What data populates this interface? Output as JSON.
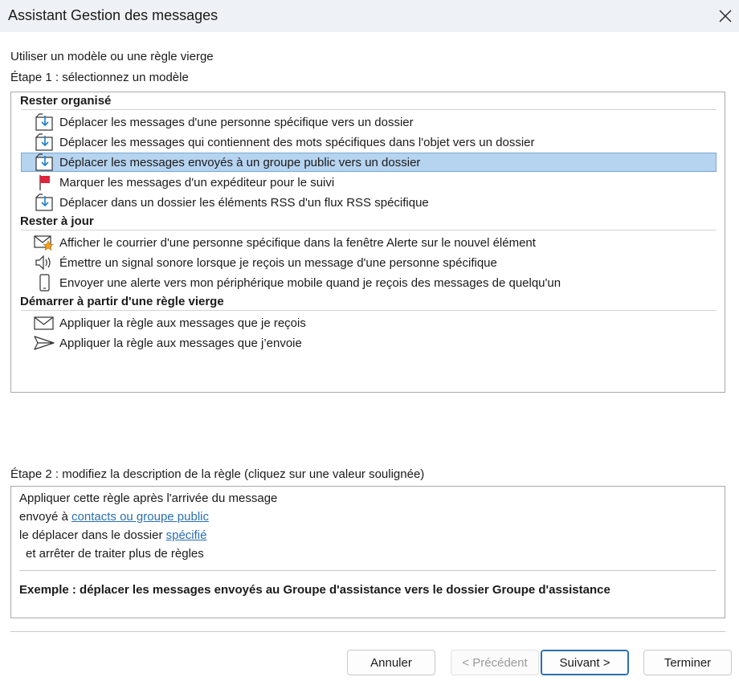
{
  "window": {
    "title": "Assistant Gestion des messages"
  },
  "intro": "Utiliser un modèle ou une règle vierge",
  "step1_label": "Étape 1 : sélectionnez un modèle",
  "groups": [
    {
      "title": "Rester organisé",
      "items": [
        {
          "label": "Déplacer les messages d'une personne spécifique vers un dossier",
          "icon": "move-to-folder-icon"
        },
        {
          "label": "Déplacer les messages qui contiennent des mots spécifiques dans l'objet vers un dossier",
          "icon": "move-to-folder-icon"
        },
        {
          "label": "Déplacer les messages envoyés à un groupe public vers un dossier",
          "icon": "move-to-folder-icon",
          "selected": true
        },
        {
          "label": "Marquer les messages d'un expéditeur pour le suivi",
          "icon": "flag-icon"
        },
        {
          "label": "Déplacer dans un dossier les éléments RSS d'un flux RSS spécifique",
          "icon": "move-to-folder-icon"
        }
      ]
    },
    {
      "title": "Rester à jour",
      "items": [
        {
          "label": "Afficher le courrier d'une personne spécifique dans la fenêtre Alerte sur le nouvel élément",
          "icon": "mail-star-icon"
        },
        {
          "label": "Émettre un signal sonore lorsque je reçois un message d'une personne spécifique",
          "icon": "speaker-icon"
        },
        {
          "label": "Envoyer une alerte vers mon périphérique mobile quand je reçois des messages de quelqu'un",
          "icon": "mobile-phone-icon"
        }
      ]
    },
    {
      "title": "Démarrer à partir d'une règle vierge",
      "items": [
        {
          "label": "Appliquer la règle aux messages que je reçois",
          "icon": "envelope-icon"
        },
        {
          "label": "Appliquer la règle aux messages que j’envoie",
          "icon": "send-icon"
        }
      ]
    }
  ],
  "step2_label": "Étape 2 : modifiez la description de la règle (cliquez sur une valeur soulignée)",
  "description": {
    "line1": "Appliquer cette règle après l'arrivée du message",
    "line2_prefix": "envoyé à ",
    "line2_link": "contacts ou groupe public",
    "line3_prefix": "le déplacer dans le dossier ",
    "line3_link": "spécifié",
    "line4": "et arrêter de traiter plus de règles",
    "example": "Exemple : déplacer les messages envoyés au Groupe d'assistance vers le dossier Groupe d'assistance"
  },
  "buttons": {
    "cancel": "Annuler",
    "previous": "< Précédent",
    "next": "Suivant >",
    "finish": "Terminer"
  },
  "colors": {
    "selection": "#b6d4f0",
    "link": "#2a6fb0",
    "icon_blue": "#1d7fd0",
    "flag_red": "#e0243a",
    "star_orange": "#f2a01c"
  }
}
